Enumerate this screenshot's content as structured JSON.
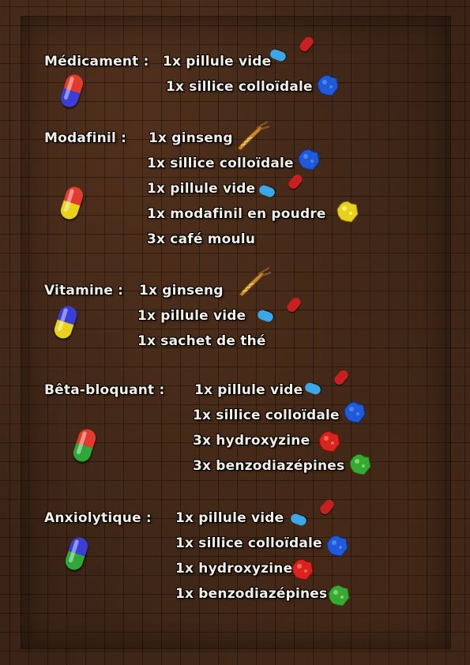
{
  "recipes": [
    {
      "name": "Médicament :",
      "capsule": {
        "top": "#e23a2c",
        "bottom": "#3a3ed8"
      },
      "ingredients": [
        {
          "text": "1x pillule vide",
          "icon": "empty-pill-icon"
        },
        {
          "text": "1x sillice colloïdale",
          "icon": "blue-powder-icon"
        }
      ]
    },
    {
      "name": "Modafinil :",
      "capsule": {
        "top": "#e23a2c",
        "bottom": "#e8d21c"
      },
      "ingredients": [
        {
          "text": "1x ginseng",
          "icon": "ginseng-root-icon"
        },
        {
          "text": "1x sillice colloïdale",
          "icon": "blue-powder-icon"
        },
        {
          "text": "1x pillule vide",
          "icon": "empty-pill-icon"
        },
        {
          "text": "1x modafinil en poudre",
          "icon": "yellow-powder-icon"
        },
        {
          "text": "3x café moulu",
          "icon": ""
        }
      ]
    },
    {
      "name": "Vitamine :",
      "capsule": {
        "top": "#3a3ed8",
        "bottom": "#e8d21c"
      },
      "ingredients": [
        {
          "text": "1x ginseng",
          "icon": "ginseng-root-icon"
        },
        {
          "text": "1x pillule vide",
          "icon": "empty-pill-icon"
        },
        {
          "text": "1x sachet de thé",
          "icon": ""
        }
      ]
    },
    {
      "name": "Bêta-bloquant :",
      "capsule": {
        "top": "#e23a2c",
        "bottom": "#2fa83a"
      },
      "ingredients": [
        {
          "text": "1x pillule vide",
          "icon": "empty-pill-icon"
        },
        {
          "text": "1x sillice colloïdale",
          "icon": "blue-powder-icon"
        },
        {
          "text": "3x hydroxyzine",
          "icon": "red-powder-icon"
        },
        {
          "text": "3x benzodiazépines",
          "icon": "green-powder-icon"
        }
      ]
    },
    {
      "name": "Anxiolytique :",
      "capsule": {
        "top": "#3a3ed8",
        "bottom": "#2fa83a"
      },
      "ingredients": [
        {
          "text": "1x pillule vide",
          "icon": "empty-pill-icon"
        },
        {
          "text": "1x sillice colloïdale",
          "icon": "blue-powder-icon"
        },
        {
          "text": "1x hydroxyzine",
          "icon": "red-powder-icon"
        },
        {
          "text": "1x benzodiazépines",
          "icon": "green-powder-icon"
        }
      ]
    }
  ],
  "colors": {
    "blue_powder": "#1f5ad8",
    "yellow_powder": "#e8d21c",
    "red_powder": "#d8241c",
    "green_powder": "#3aa834",
    "pill_blue": "#3aa8e8",
    "pill_red": "#c82020"
  }
}
